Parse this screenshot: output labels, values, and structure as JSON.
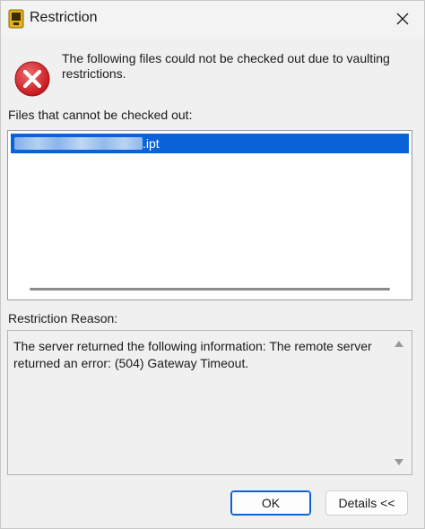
{
  "window": {
    "title": "Restriction",
    "close_icon": "close-icon",
    "app_icon": "vault-app-icon"
  },
  "message": {
    "icon": "error-icon",
    "text": "The following files could not be checked out due to vaulting restrictions."
  },
  "files": {
    "label": "Files that cannot be checked out:",
    "items": [
      {
        "name_suffix": ".ipt",
        "name_redacted": true,
        "selected": true
      }
    ]
  },
  "reason": {
    "label": "Restriction Reason:",
    "text": "The server returned the following information:  The remote server returned an error: (504) Gateway Timeout."
  },
  "buttons": {
    "ok": "OK",
    "details": "Details <<"
  },
  "colors": {
    "selection": "#0a64d8",
    "error_red": "#d9232d",
    "app_icon_yellow": "#e3b01c"
  }
}
